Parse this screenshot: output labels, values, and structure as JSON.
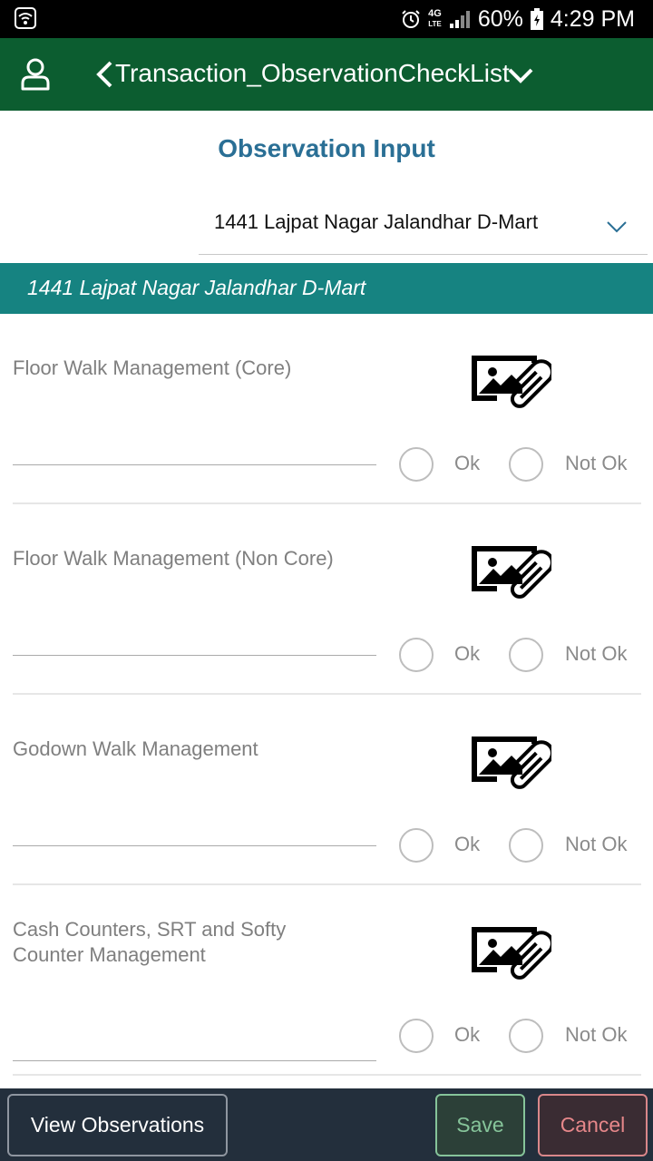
{
  "status_bar": {
    "battery": "60%",
    "time": "4:29 PM",
    "network": "4G",
    "network_sub": "LTE"
  },
  "app_bar": {
    "title": "Transaction_ObservationCheckList"
  },
  "page": {
    "title": "Observation Input"
  },
  "store_select": {
    "value": "1441 Lajpat Nagar Jalandhar D-Mart"
  },
  "section": {
    "header": "1441 Lajpat Nagar Jalandhar D-Mart"
  },
  "checklist": [
    {
      "label": "Floor Walk Management (Core)",
      "ok_label": "Ok",
      "not_ok_label": "Not Ok",
      "remark": ""
    },
    {
      "label": "Floor Walk Management (Non Core)",
      "ok_label": "Ok",
      "not_ok_label": "Not Ok",
      "remark": ""
    },
    {
      "label": "Godown Walk Management",
      "ok_label": "Ok",
      "not_ok_label": "Not Ok",
      "remark": ""
    },
    {
      "label": "Cash Counters, SRT and Softy Counter Management",
      "ok_label": "Ok",
      "not_ok_label": "Not Ok",
      "remark": ""
    }
  ],
  "bottom_bar": {
    "view_label": "View Observations",
    "save_label": "Save",
    "cancel_label": "Cancel"
  },
  "colors": {
    "app_bar": "#0c5d30",
    "section_header": "#168381",
    "page_title": "#2a6f95",
    "bottom_bar": "#232f3c",
    "save_accent": "#86c49a",
    "cancel_accent": "#e6878a"
  },
  "icons": [
    "wifi-icon",
    "alarm-icon",
    "signal-icon",
    "battery-icon",
    "user-icon",
    "back-icon",
    "chevron-down-icon",
    "image-attach-icon"
  ]
}
